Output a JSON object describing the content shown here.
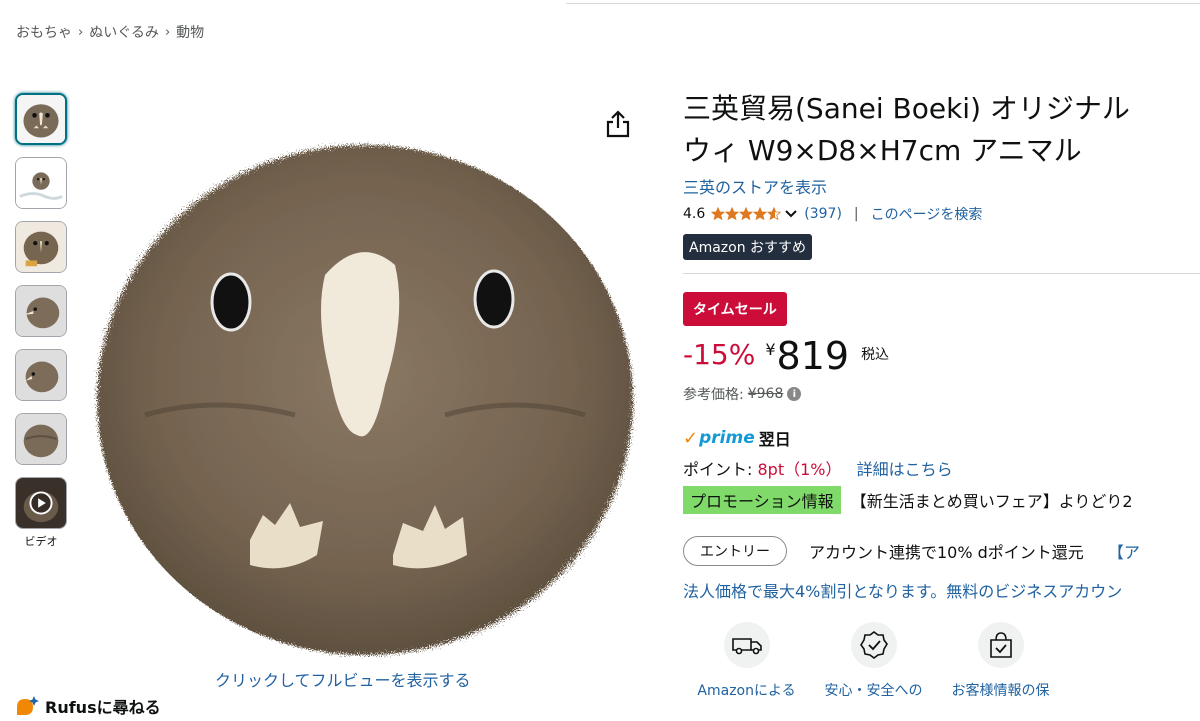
{
  "breadcrumb": {
    "items": [
      "おもちゃ",
      "ぬいぐるみ",
      "動物"
    ],
    "separator": "›"
  },
  "gallery": {
    "video_label": "ビデオ",
    "fullview_link": "クリックしてフルビューを表示する"
  },
  "rufus": {
    "label": "Rufusに尋ねる"
  },
  "product": {
    "title_line1": "三英貿易(Sanei Boeki) オリジナル",
    "title_line2": "ウィ W9×D8×H7cm アニマル",
    "store_link": "三英のストアを表示",
    "rating_value": "4.6",
    "rating_stars": 4.6,
    "rating_count": "(397)",
    "rating_divider": "|",
    "search_page_link": "このページを検索",
    "choice_badge": "Amazon おすすめ"
  },
  "pricing": {
    "deal_badge": "タイムセール",
    "discount": "-15%",
    "currency": "¥",
    "price": "819",
    "tax_label": "税込",
    "list_price_label": "参考価格:",
    "list_price": "¥968",
    "info_icon": "i"
  },
  "delivery": {
    "prime_label": "prime",
    "prime_check": "✓",
    "delivery_day": "翌日"
  },
  "points": {
    "label": "ポイント:",
    "value": "8pt（1%）",
    "details_link": "詳細はこちら"
  },
  "promotion": {
    "badge": "プロモーション情報",
    "text": "【新生活まとめ買いフェア】よりどり2"
  },
  "entry": {
    "button": "エントリー",
    "text": "アカウント連携で10% dポイント還元",
    "link": "【ア"
  },
  "business": {
    "text": "法人価格で最大4%割引となります。無料のビジネスアカウン"
  },
  "features": [
    {
      "icon": "delivery-van-icon",
      "label": "Amazonによる"
    },
    {
      "icon": "safety-badge-icon",
      "label": "安心・安全への"
    },
    {
      "icon": "secure-bag-icon",
      "label": "お客様情報の保"
    }
  ],
  "colors": {
    "link": "#2162a1",
    "deal_red": "#cc0c39",
    "star_orange": "#de7921",
    "promo_green": "#7fda69",
    "prime_blue": "#1399d6",
    "choice_dark": "#232f3e"
  }
}
